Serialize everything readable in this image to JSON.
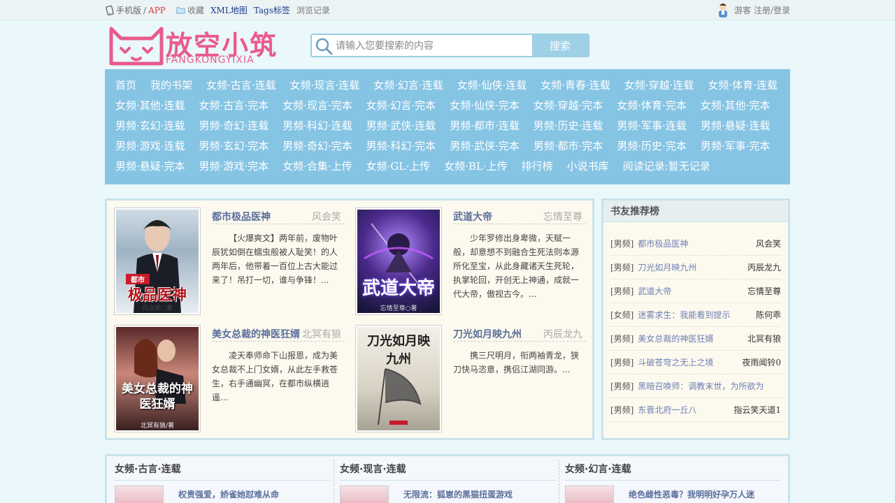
{
  "topbar": {
    "mobile_label": "手机版",
    "sep": "/",
    "app_label": "APP",
    "links": [
      {
        "label": "收藏",
        "style": "gray"
      },
      {
        "label": "XML地图",
        "style": "blue"
      },
      {
        "label": "Tags标签",
        "style": "blue"
      },
      {
        "label": "浏览记录",
        "style": "gray"
      }
    ],
    "guest_label": "游客 注册/登录"
  },
  "logo": {
    "title": "放空小筑",
    "subtitle": "FANGKONGYIXIA"
  },
  "search": {
    "placeholder": "请输入您要搜索的内容",
    "button": "搜索"
  },
  "nav": {
    "rows": [
      [
        "首页",
        "我的书架",
        "女频·古言·连载",
        "女频·现言·连载",
        "女频·幻言·连载",
        "女频·仙侠·连载",
        "女频·青春·连载",
        "女频·穿越·连载",
        "女频·体育·连载"
      ],
      [
        "女频·其他·连载",
        "女频·古言·完本",
        "女频·现言·完本",
        "女频·幻言·完本",
        "女频·仙侠·完本",
        "女频·穿越·完本",
        "女频·体育·完本",
        "女频·其他·完本"
      ],
      [
        "男频·玄幻·连载",
        "男频·奇幻·连载",
        "男频·科幻·连载",
        "男频·武侠·连载",
        "男频·都市·连载",
        "男频·历史·连载",
        "男频·军事·连载",
        "男频·悬疑·连载"
      ],
      [
        "男频·游戏·连载",
        "男频·玄幻·完本",
        "男频·奇幻·完本",
        "男频·科幻·完本",
        "男频·武侠·完本",
        "男频·都市·完本",
        "男频·历史·完本",
        "男频·军事·完本"
      ],
      [
        "男频·悬疑·完本",
        "男频·游戏·完本",
        "女频·合集·上传",
        "女频·GL·上传",
        "女频·BL·上传",
        "排行榜",
        "小说书库",
        "阅读记录:暂无记录"
      ]
    ]
  },
  "featured": [
    {
      "title": "都市极品医神",
      "author": "风会笑",
      "desc": "【火爆爽文】两年前，废物叶辰犹如倒在蠕虫般被人耻笑！的人两年后，他带着一百位上古大能过来了！吊打一切，谁与争锋！...",
      "cover_text": "极品医神",
      "cover_top": "都市",
      "cover_author": "风会笑○著"
    },
    {
      "title": "武道大帝",
      "author": "忘情至尊",
      "desc": "少年罗修出身卑微，天赋一般，却意想不到融合生死法则本源所化至宝，从此身藏诸天生死轮，执掌轮回，开创无上神通，成就一代大帝，傲视古今。...",
      "cover_text": "武道大帝",
      "cover_author": "忘情至尊○著"
    },
    {
      "title": "美女总裁的神医狂婿",
      "author": "北冥有狼",
      "desc": "凌天奉师命下山报恩，成为美女总裁不上门女婿，从此左手救苍生，右手通幽冥，在都市纵横逍遥...",
      "cover_text": "美女总裁的神医狂婿",
      "cover_author": "北冥有狼/著"
    },
    {
      "title": "刀光如月映九州",
      "author": "丙辰龙九",
      "desc": "携三尺明月，衔两袖青龙，狭刀快马恣意，携侣江湖同游。...",
      "cover_text": "刀光如月映九州"
    }
  ],
  "rank": {
    "title": "书友推荐榜",
    "items": [
      {
        "cat": "[男频]",
        "name": "都市极品医神",
        "author": "风会笑"
      },
      {
        "cat": "[男频]",
        "name": "刀光如月映九州",
        "author": "丙辰龙九"
      },
      {
        "cat": "[男频]",
        "name": "武道大帝",
        "author": "忘情至尊"
      },
      {
        "cat": "[女频]",
        "name": "迷雾求生：我能看到提示",
        "author": "陈何乖"
      },
      {
        "cat": "[男频]",
        "name": "美女总裁的神医狂婿",
        "author": "北冥有狼"
      },
      {
        "cat": "[男频]",
        "name": "斗破苍穹之无上之境",
        "author": "夜雨闻铃0"
      },
      {
        "cat": "[男频]",
        "name": "黑暗召唤师：调教末世，为所欲为",
        "author": ""
      },
      {
        "cat": "[男频]",
        "name": "东晋北府一丘八",
        "author": "指云笑天道1"
      }
    ]
  },
  "sections": [
    {
      "head": "女频·古言·连载",
      "first_title": "权贵强爱，娇雀她怼难从命"
    },
    {
      "head": "女频·现言·连载",
      "first_title": "无限流：狐崽的黑猫扭蛋游戏"
    },
    {
      "head": "女频·幻言·连载",
      "first_title": "绝色雌性恶毒？我明明好孕万人迷"
    }
  ]
}
